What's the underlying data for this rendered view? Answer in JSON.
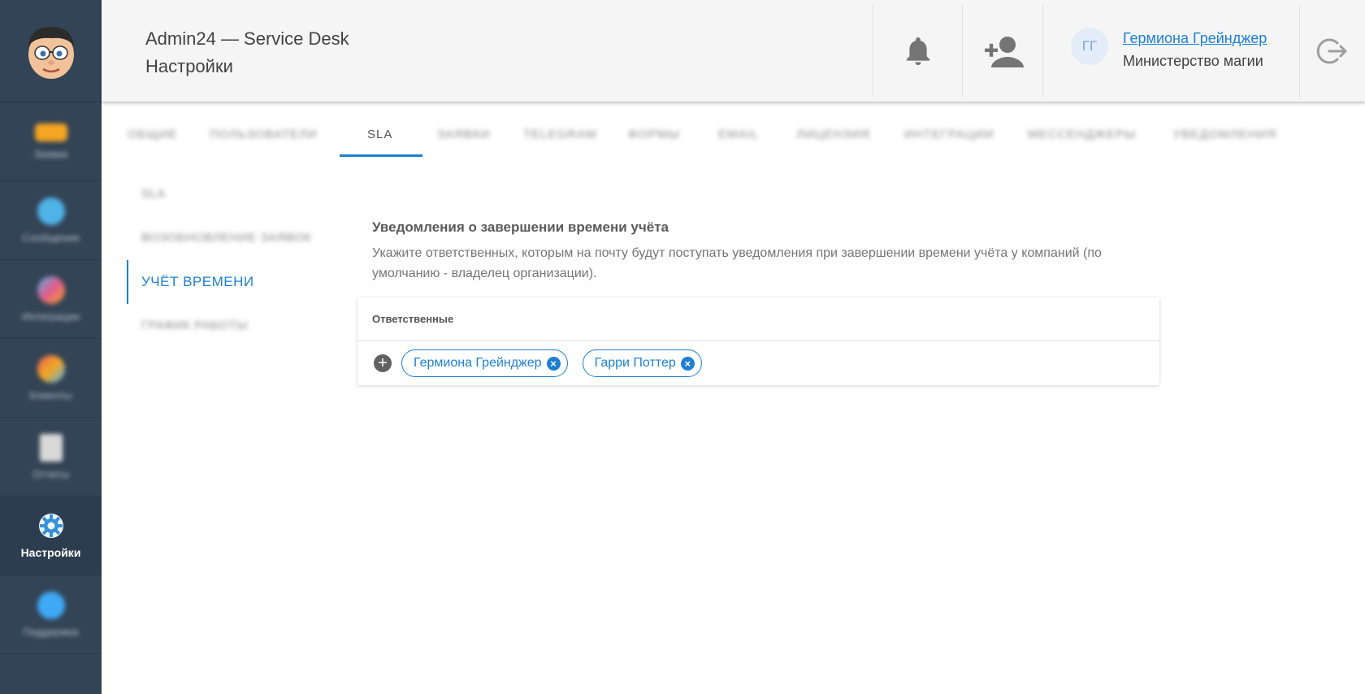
{
  "colors": {
    "sidebar": "#334456",
    "accent": "#1e7fd1",
    "header": "#f5f5f5"
  },
  "sidebar": {
    "logo_icon": "cartoon-face-logo-icon",
    "items": [
      {
        "label": "Заявки",
        "icon": "tickets-icon",
        "color": "#f5a623"
      },
      {
        "label": "Сообщения",
        "icon": "messages-icon",
        "color": "#4fb3e8"
      },
      {
        "label": "Интеграции",
        "icon": "integrations-icon",
        "color": "#e25c8c"
      },
      {
        "label": "Клиенты",
        "icon": "clients-icon",
        "color": "#e85c5c"
      },
      {
        "label": "Отчеты",
        "icon": "reports-icon",
        "color": "#d9d9d9"
      },
      {
        "label": "Настройки",
        "icon": "gear-icon",
        "color": "#4fb3e8"
      },
      {
        "label": "Поддержка",
        "icon": "support-icon",
        "color": "#3fa9f5"
      }
    ]
  },
  "header": {
    "app_title": "Admin24 — Service Desk",
    "page_title": "Настройки",
    "user_initials": "ГГ",
    "user_name": "Гермиона Грейнджер",
    "user_org": "Министерство магии"
  },
  "tabs": [
    {
      "label": "Общие"
    },
    {
      "label": "Пользователи"
    },
    {
      "label": "SLA"
    },
    {
      "label": "Заявки"
    },
    {
      "label": "Telegram"
    },
    {
      "label": "Формы"
    },
    {
      "label": "Email"
    },
    {
      "label": "Лицензия"
    },
    {
      "label": "Интеграции"
    },
    {
      "label": "Мессенджеры"
    },
    {
      "label": "Уведомления"
    }
  ],
  "subnav": [
    {
      "label": "SLA"
    },
    {
      "label": "Возобновление заявок"
    },
    {
      "label": "Учёт времени"
    },
    {
      "label": "График работы"
    }
  ],
  "content": {
    "title": "Уведомления о завершении времени учёта",
    "description": "Укажите ответственных, которым на почту будут поступать уведомления при завершении времени учёта у компаний (по умолчанию - владелец организации).",
    "card_header": "Ответственные",
    "chips": [
      {
        "label": "Гермиона Грейнджер"
      },
      {
        "label": "Гарри Поттер"
      }
    ]
  }
}
